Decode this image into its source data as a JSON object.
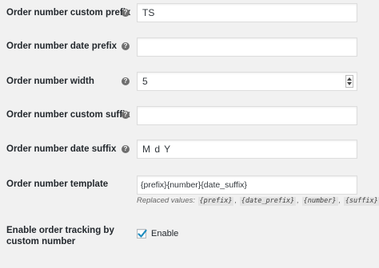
{
  "settings": [
    {
      "label": "Order number custom prefix",
      "value": "TS"
    },
    {
      "label": "Order number date prefix",
      "value": ""
    },
    {
      "label": "Order number width",
      "value": "5"
    },
    {
      "label": "Order number custom suffix",
      "value": ""
    },
    {
      "label": "Order number date suffix",
      "value": "M d Y"
    },
    {
      "label": "Order number template",
      "value": "{prefix}{number}{date_suffix}"
    }
  ],
  "template_hint": {
    "prefix_text": "Replaced values:",
    "codes": [
      "{prefix}",
      "{date_prefix}",
      "{number}",
      "{suffix}"
    ],
    "separator": ","
  },
  "tracking": {
    "label_line1": "Enable order tracking by",
    "label_line2": "custom number",
    "checkbox_label": "Enable",
    "checked": true
  },
  "help_glyph": "?",
  "icons": {
    "help": "help-question-icon",
    "check": "checkmark-icon",
    "stepper": "number-stepper-icon"
  },
  "colors": {
    "background": "#f1f1f1",
    "check": "#1e8cbe"
  }
}
